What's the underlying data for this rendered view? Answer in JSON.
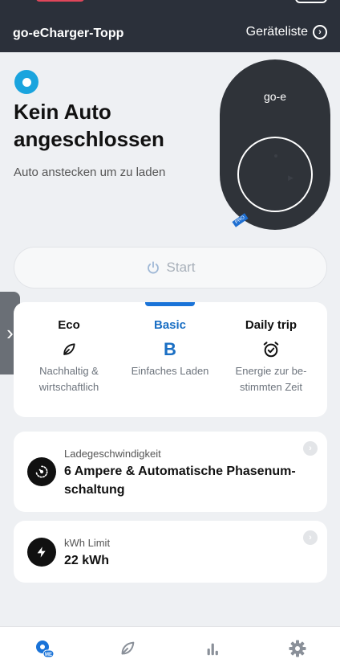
{
  "header": {
    "title": "go-eCharger-Topp",
    "device_list_label": "Geräteliste"
  },
  "status": {
    "headline": "Kein Auto angeschlossen",
    "subline": "Auto anstecken um zu laden",
    "dot_color": "#1aa4de"
  },
  "charger": {
    "logo": "go-e",
    "badge": "PRO"
  },
  "start_button": {
    "label": "Start",
    "icon": "power-icon"
  },
  "modes": [
    {
      "name": "Eco",
      "icon": "leaf-icon",
      "desc_line1": "Nachhaltig &",
      "desc_line2": "wirtschaftlich",
      "active": false
    },
    {
      "name": "Basic",
      "icon": "B",
      "desc_line1": "Einfaches Laden",
      "desc_line2": "",
      "active": true
    },
    {
      "name": "Daily trip",
      "icon": "alarm-clock-icon",
      "desc_line1": "Energie zur be-",
      "desc_line2": "stimmten Zeit",
      "active": false
    }
  ],
  "cards": {
    "speed": {
      "label": "Ladegeschwindigkeit",
      "value": "6 Ampere & Automatische Phasenum­schaltung",
      "icon": "speedometer-icon"
    },
    "limit": {
      "label": "kWh Limit",
      "value": "22 kWh",
      "icon": "lightning-icon"
    }
  },
  "tabbar": {
    "tabs": [
      "home-icon",
      "leaf-icon",
      "chart-icon",
      "settings-icon"
    ],
    "home_badge": "ME"
  },
  "colors": {
    "header_bg": "#2b303a",
    "accent": "#1a73d8",
    "background": "#eef0f3"
  }
}
